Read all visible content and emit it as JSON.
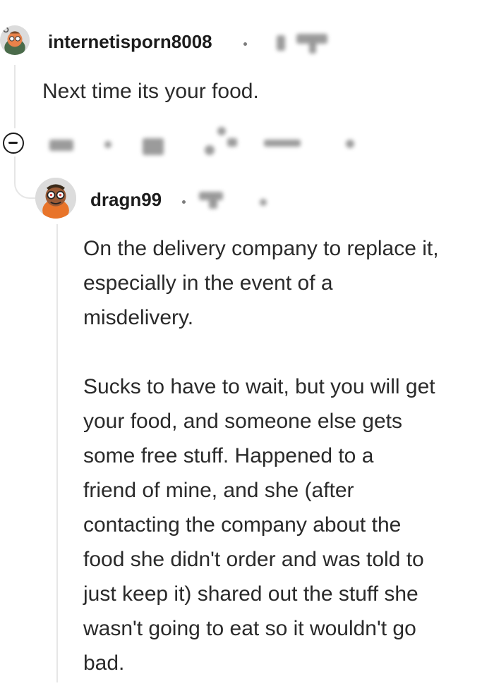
{
  "comments": [
    {
      "username": "internetisporn8008",
      "text": "Next time its your food."
    },
    {
      "username": "dragn99",
      "paragraphs": [
        [
          "On the delivery company to replace it,",
          "especially in the event of a",
          "misdelivery."
        ],
        [
          "Sucks to have to wait, but you will get",
          "your food, and someone else gets",
          "some free stuff. Happened to a",
          "friend of mine, and she (after",
          "contacting the company about the",
          "food she didn't order and was told to",
          "just keep it) shared out the stuff she",
          "wasn't going to eat so it wouldn't go",
          "bad."
        ]
      ]
    }
  ],
  "icons": {
    "collapse": "collapse-minus-icon",
    "avatar": "snoo-avatar-icon"
  },
  "colors": {
    "text": "#1c1c1c",
    "thread_line": "#e6e6e6",
    "meta_gray": "#7c7c7c"
  }
}
